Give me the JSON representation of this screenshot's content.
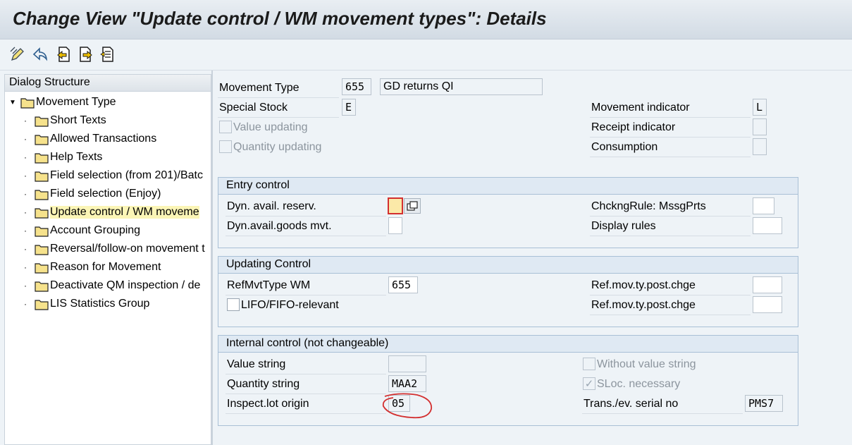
{
  "window": {
    "title": "Change View \"Update control / WM movement types\": Details"
  },
  "toolbar": {
    "buttons": [
      {
        "name": "display-change-icon"
      },
      {
        "name": "undo-icon"
      },
      {
        "name": "previous-entry-icon"
      },
      {
        "name": "next-entry-icon"
      },
      {
        "name": "select-entry-icon"
      }
    ]
  },
  "dialog": {
    "header": "Dialog Structure",
    "root": "Movement Type",
    "items": [
      "Short Texts",
      "Allowed Transactions",
      "Help Texts",
      "Field selection (from 201)/Batc",
      "Field selection (Enjoy)",
      "Update control / WM moveme",
      "Account Grouping",
      "Reversal/follow-on movement t",
      "Reason for Movement",
      "Deactivate QM inspection / de",
      "LIS Statistics Group"
    ],
    "selected_index": 5
  },
  "header": {
    "movement_type_label": "Movement Type",
    "movement_type_value": "655",
    "movement_type_desc": "GD returns QI",
    "special_stock_label": "Special Stock",
    "special_stock_value": "E",
    "value_updating_label": "Value updating",
    "quantity_updating_label": "Quantity updating",
    "movement_indicator_label": "Movement indicator",
    "movement_indicator_value": "L",
    "receipt_indicator_label": "Receipt indicator",
    "receipt_indicator_value": "",
    "consumption_label": "Consumption",
    "consumption_value": ""
  },
  "entry_control": {
    "title": "Entry control",
    "dyn_avail_reserv_label": "Dyn. avail. reserv.",
    "dyn_avail_reserv_value": "",
    "dyn_avail_goods_label": "Dyn.avail.goods mvt.",
    "dyn_avail_goods_value": "",
    "checking_rule_label": "ChckngRule: MssgPrts",
    "checking_rule_value": "",
    "display_rules_label": "Display rules",
    "display_rules_value": ""
  },
  "updating_control": {
    "title": "Updating Control",
    "ref_mvt_type_label": "RefMvtType WM",
    "ref_mvt_type_value": "655",
    "lifo_fifo_label": "LIFO/FIFO-relevant",
    "lifo_fifo_checked": false,
    "ref_post_chge_1_label": "Ref.mov.ty.post.chge",
    "ref_post_chge_1_value": "",
    "ref_post_chge_2_label": "Ref.mov.ty.post.chge",
    "ref_post_chge_2_value": ""
  },
  "internal_control": {
    "title": "Internal control (not changeable)",
    "value_string_label": "Value string",
    "value_string_value": "",
    "quantity_string_label": "Quantity string",
    "quantity_string_value": "MAA2",
    "inspect_lot_label": "Inspect.lot origin",
    "inspect_lot_value": "05",
    "without_value_string_label": "Without value string",
    "without_value_string_checked": false,
    "sloc_necessary_label": "SLoc. necessary",
    "sloc_necessary_checked": true,
    "serial_no_label": "Trans./ev. serial no",
    "serial_no_value": "PMS7"
  },
  "colors": {
    "background": "#eef3f7",
    "group_border": "#a9c0d6",
    "group_header": "#dfe9f3",
    "selected_item": "#fbf5b6",
    "annotation": "#d32f2f",
    "folder": "#f6e28c"
  }
}
